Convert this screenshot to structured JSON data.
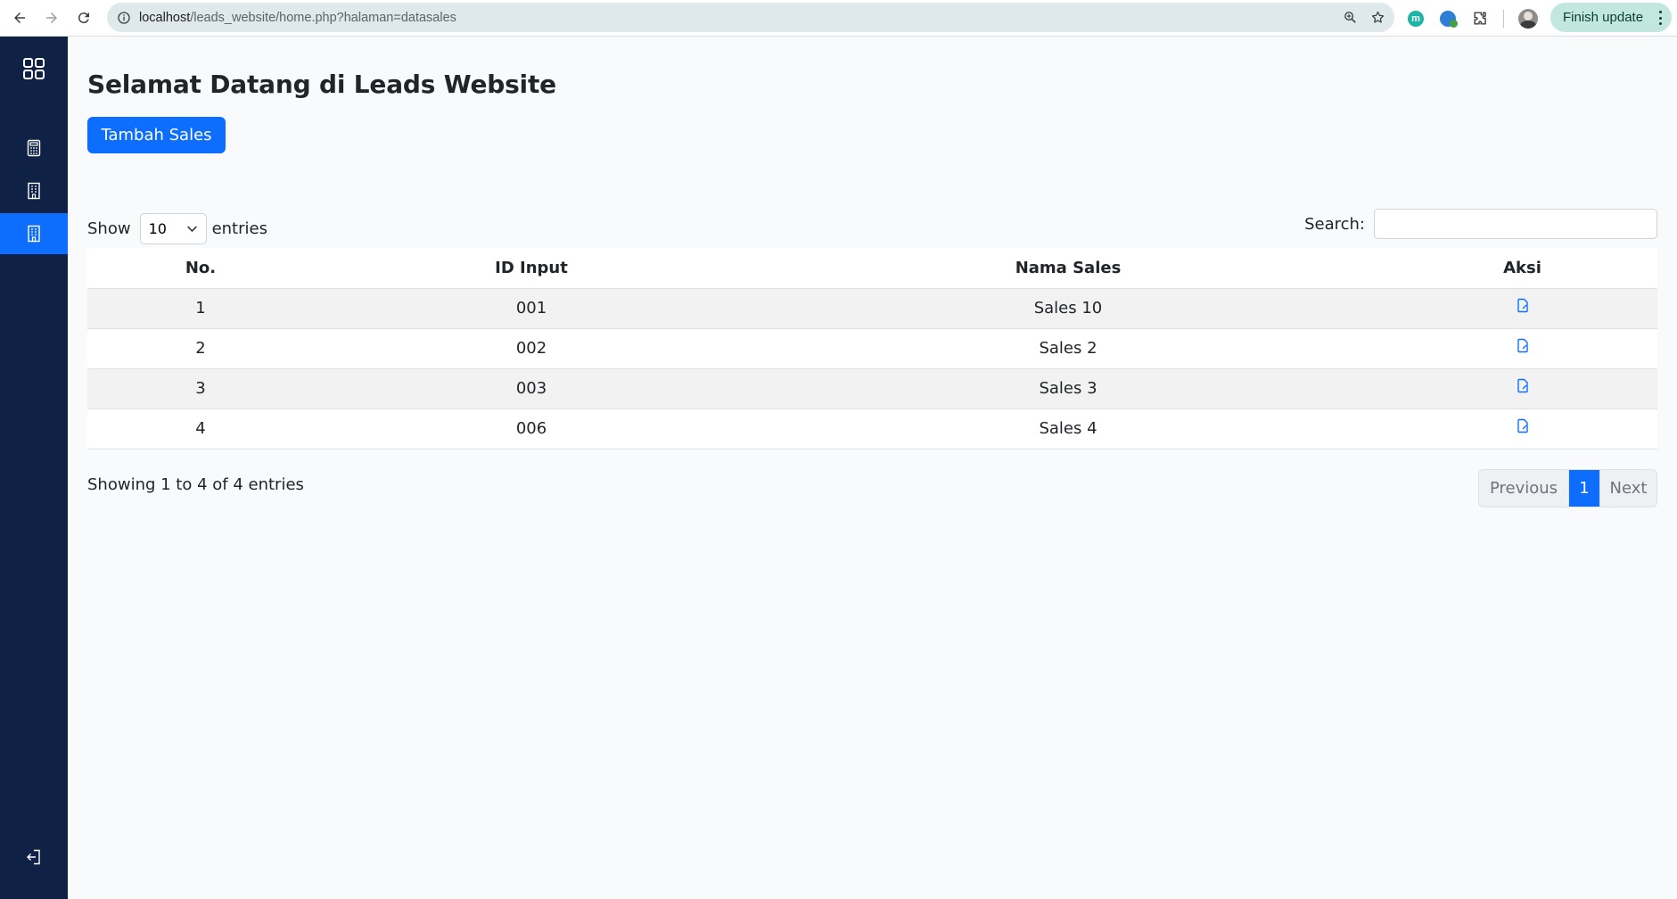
{
  "browser": {
    "url_host": "localhost",
    "url_path": "/leads_website/home.php?halaman=datasales",
    "finish_update_label": "Finish update",
    "extension_m_letter": "m"
  },
  "sidebar": {
    "items": [
      {
        "icon": "calculator-icon",
        "active": false
      },
      {
        "icon": "building-icon",
        "active": false
      },
      {
        "icon": "building-icon",
        "active": true
      }
    ],
    "logout_icon": "logout-icon"
  },
  "page": {
    "title": "Selamat Datang di Leads Website",
    "add_button_label": "Tambah Sales"
  },
  "table_controls": {
    "show_label": "Show",
    "entries_label": "entries",
    "page_length": "10",
    "search_label": "Search:",
    "search_value": ""
  },
  "table": {
    "headers": [
      "No.",
      "ID Input",
      "Nama Sales",
      "Aksi"
    ],
    "rows": [
      {
        "no": "1",
        "id": "001",
        "nama": "Sales 10"
      },
      {
        "no": "2",
        "id": "002",
        "nama": "Sales 2"
      },
      {
        "no": "3",
        "id": "003",
        "nama": "Sales 3"
      },
      {
        "no": "4",
        "id": "006",
        "nama": "Sales 4"
      }
    ],
    "action_icon": "edit-file-icon"
  },
  "footer": {
    "info": "Showing 1 to 4 of 4 entries",
    "previous_label": "Previous",
    "current_page": "1",
    "next_label": "Next"
  },
  "colors": {
    "sidebar_bg": "#0f2145",
    "accent": "#0d6efd",
    "page_bg": "#f8fafc"
  }
}
